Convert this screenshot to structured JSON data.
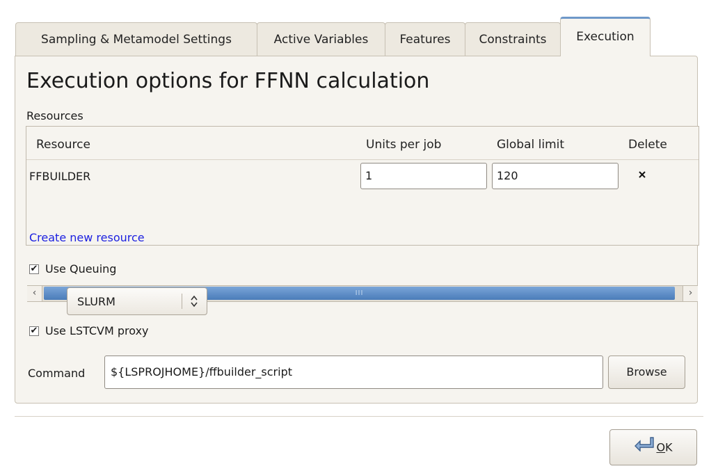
{
  "tabs": [
    {
      "label": "Sampling & Metamodel Settings",
      "active": false
    },
    {
      "label": "Active Variables",
      "active": false
    },
    {
      "label": "Features",
      "active": false
    },
    {
      "label": "Constraints",
      "active": false
    },
    {
      "label": "Execution",
      "active": true
    }
  ],
  "panel": {
    "title": "Execution options for FFNN calculation",
    "resources_label": "Resources"
  },
  "resources_table": {
    "columns": [
      "Resource",
      "Units per job",
      "Global limit",
      "Delete"
    ],
    "rows": [
      {
        "resource": "FFBUILDER",
        "units_per_job": "1",
        "global_limit": "120",
        "delete_icon": "close-x-icon"
      }
    ],
    "create_link": "Create new resource",
    "scrollbar_grip": "III"
  },
  "options": {
    "use_queuing_label": "Use Queuing",
    "use_queuing_checked": true,
    "queue_system": "SLURM",
    "use_proxy_label": "Use LSTCVM proxy",
    "use_proxy_checked": true,
    "check_glyph": "✔"
  },
  "command": {
    "label": "Command",
    "value": "${LSPROJHOME}/ffbuilder_script",
    "browse_label": "Browse"
  },
  "footer": {
    "ok_mnemonic": "O",
    "ok_rest": "K"
  },
  "colors": {
    "link": "#1b1fe0",
    "scroll_thumb": "#4a7cb9",
    "active_tab_accent": "#6e98c9",
    "panel_bg": "#f6f4ef"
  }
}
